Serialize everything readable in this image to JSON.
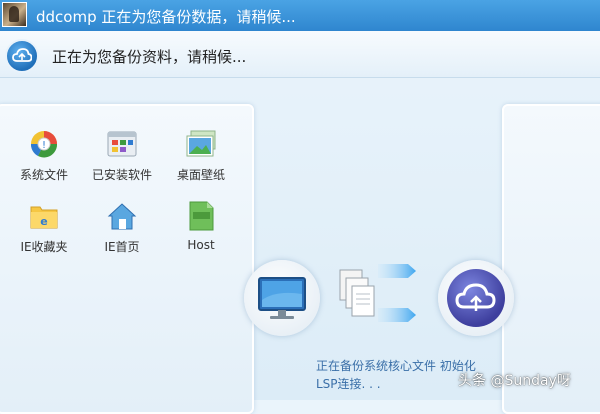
{
  "window": {
    "title": "ddcomp 正在为您备份数据，请稍候..."
  },
  "status": {
    "icon": "cloud-backup-icon",
    "message": "正在为您备份资料，请稍候..."
  },
  "backup_items": [
    {
      "label": "系统文件",
      "icon": "system-file-icon"
    },
    {
      "label": "已安装软件",
      "icon": "installed-software-icon"
    },
    {
      "label": "桌面壁纸",
      "icon": "wallpaper-icon"
    },
    {
      "label": "IE收藏夹",
      "icon": "ie-favorites-icon"
    },
    {
      "label": "IE首页",
      "icon": "ie-homepage-icon"
    },
    {
      "label": "Host",
      "icon": "host-file-icon"
    }
  ],
  "transfer": {
    "source_icon": "monitor-icon",
    "files_icon": "documents-icon",
    "arrows_icon": "transfer-arrows-icon",
    "target_icon": "cloud-sync-icon",
    "progress_text": "正在备份系统核心文件 初始化LSP连接. . ."
  },
  "watermark": "头条 @Sunday呀",
  "colors": {
    "titlebar": "#2f86cf",
    "progress_text": "#3a6fa8",
    "cloud_accent": "#3e3f9e"
  }
}
